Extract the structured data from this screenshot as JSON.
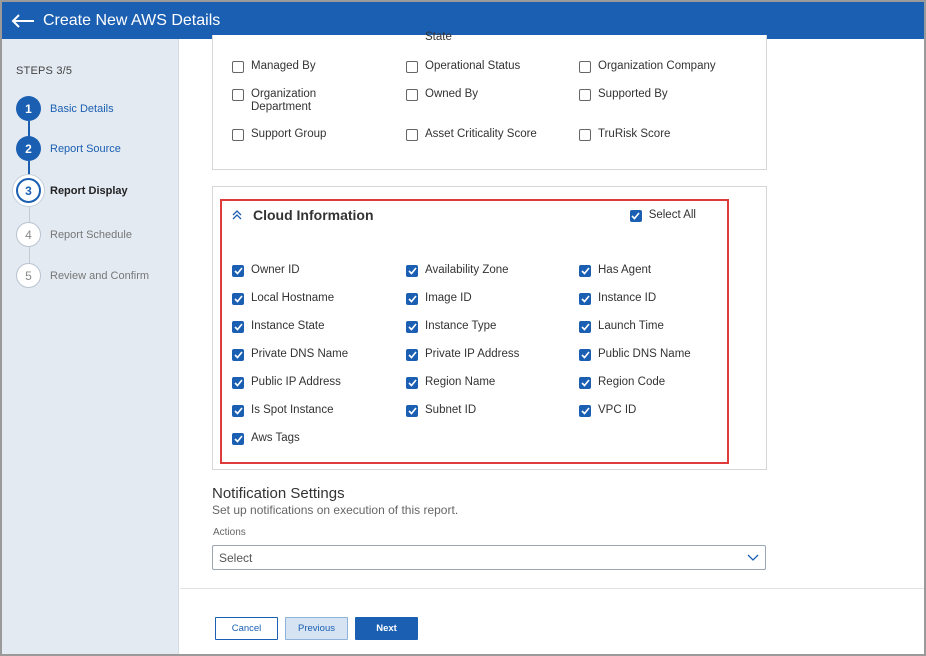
{
  "header": {
    "title": "Create New AWS Details"
  },
  "sidebar": {
    "steps_label": "STEPS 3/5",
    "steps": [
      {
        "number": "1",
        "label": "Basic Details"
      },
      {
        "number": "2",
        "label": "Report Source"
      },
      {
        "number": "3",
        "label": "Report Display"
      },
      {
        "number": "4",
        "label": "Report Schedule"
      },
      {
        "number": "5",
        "label": "Review and Confirm"
      }
    ]
  },
  "asset_fields": {
    "partial_label": "State",
    "items": [
      {
        "label": "Managed By",
        "checked": false
      },
      {
        "label": "Operational Status",
        "checked": false
      },
      {
        "label": "Organization Company",
        "checked": false
      },
      {
        "label": "Organization Department",
        "checked": false
      },
      {
        "label": "Owned By",
        "checked": false
      },
      {
        "label": "Supported By",
        "checked": false
      },
      {
        "label": "Support Group",
        "checked": false
      },
      {
        "label": "Asset Criticality Score",
        "checked": false
      },
      {
        "label": "TruRisk Score",
        "checked": false
      }
    ]
  },
  "cloud_information": {
    "title": "Cloud Information",
    "select_all_label": "Select All",
    "select_all_checked": true,
    "items": [
      {
        "label": "Owner ID",
        "checked": true
      },
      {
        "label": "Availability Zone",
        "checked": true
      },
      {
        "label": "Has Agent",
        "checked": true
      },
      {
        "label": "Local Hostname",
        "checked": true
      },
      {
        "label": "Image ID",
        "checked": true
      },
      {
        "label": "Instance ID",
        "checked": true
      },
      {
        "label": "Instance State",
        "checked": true
      },
      {
        "label": "Instance Type",
        "checked": true
      },
      {
        "label": "Launch Time",
        "checked": true
      },
      {
        "label": "Private DNS Name",
        "checked": true
      },
      {
        "label": "Private IP Address",
        "checked": true
      },
      {
        "label": "Public DNS Name",
        "checked": true
      },
      {
        "label": "Public IP Address",
        "checked": true
      },
      {
        "label": "Region Name",
        "checked": true
      },
      {
        "label": "Region Code",
        "checked": true
      },
      {
        "label": "Is Spot Instance",
        "checked": true
      },
      {
        "label": "Subnet ID",
        "checked": true
      },
      {
        "label": "VPC ID",
        "checked": true
      },
      {
        "label": "Aws Tags",
        "checked": true
      }
    ]
  },
  "notification": {
    "title": "Notification Settings",
    "subtitle": "Set up notifications on execution of this report.",
    "actions_label": "Actions",
    "select_value": "Select"
  },
  "footer": {
    "cancel_label": "Cancel",
    "previous_label": "Previous",
    "next_label": "Next"
  },
  "colors": {
    "primary": "#1b5fb2",
    "highlight": "#e03b3b",
    "sidebar_bg": "#e3eaf2"
  }
}
